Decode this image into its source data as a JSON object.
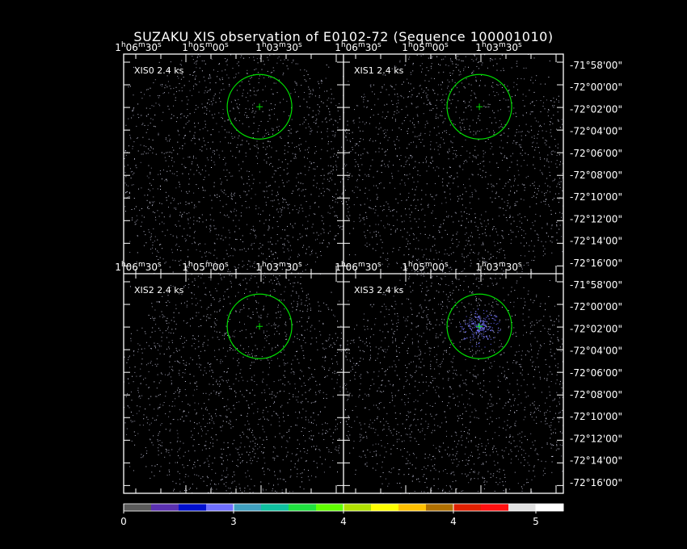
{
  "title": "SUZAKU XIS observation of E0102-72  (Sequence 100001010)",
  "panels": [
    {
      "label": "XIS0 2.4 ks"
    },
    {
      "label": "XIS1 2.4 ks"
    },
    {
      "label": "XIS2 2.4 ks"
    },
    {
      "label": "XIS3 2.4 ks"
    }
  ],
  "ra_ticks_top": [
    {
      "h": "1",
      "m": "06",
      "s": "30",
      "sunit": "s"
    },
    {
      "h": "1",
      "m": "05",
      "s": "00",
      "sunit": "s"
    },
    {
      "h": "1",
      "m": "03",
      "s": "30",
      "sunit": "s"
    }
  ],
  "ra_ticks_mid": [
    {
      "h": "1",
      "m": "06",
      "s": "30",
      "sunit": "s"
    },
    {
      "h": "1",
      "m": "05",
      "s": "00",
      "sunit": "s"
    },
    {
      "h": "1",
      "m": "03",
      "s": "30",
      "sunit": "s"
    }
  ],
  "dec_labels": [
    "-71°58'00\"",
    "-72°00'00\"",
    "-72°02'00\"",
    "-72°04'00\"",
    "-72°06'00\"",
    "-72°08'00\"",
    "-72°10'00\"",
    "-72°12'00\"",
    "-72°14'00\"",
    "-72°16'00\""
  ],
  "colorbar": {
    "colors": [
      "#5a5a5a",
      "#5a30b0",
      "#0010d0",
      "#7070ff",
      "#40a0c0",
      "#10c0a0",
      "#20e040",
      "#60ff00",
      "#b0e000",
      "#ffff00",
      "#ffc000",
      "#b07000",
      "#e02000",
      "#ff1010",
      "#e0e0e0",
      "#ffffff"
    ],
    "labels": [
      "0",
      "3",
      "4",
      "4",
      "5"
    ]
  },
  "source_circle_color": "#00e000"
}
